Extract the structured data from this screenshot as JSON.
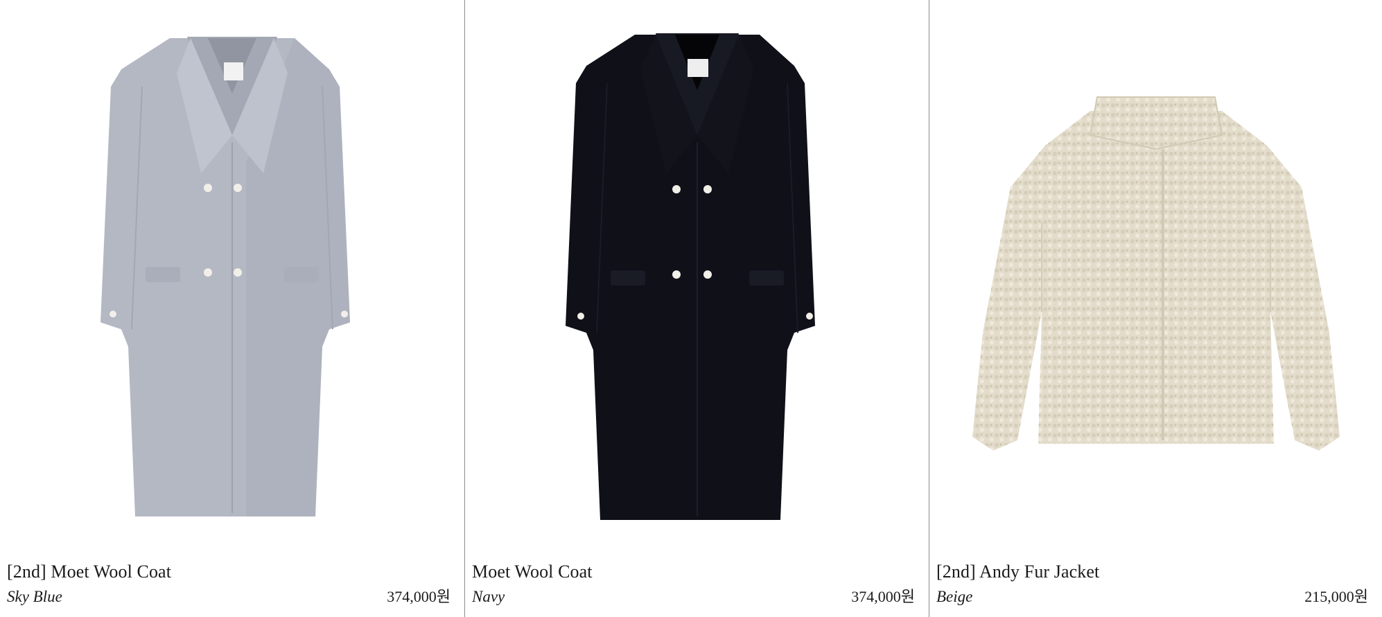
{
  "products": [
    {
      "name": "[2nd] Moet Wool Coat",
      "color": "Sky Blue",
      "price": "374,000원",
      "image_icon": "coat-image",
      "swatch": "#b3b8c3"
    },
    {
      "name": "Moet Wool Coat",
      "color": "Navy",
      "price": "374,000원",
      "image_icon": "coat-image",
      "swatch": "#0f1018"
    },
    {
      "name": "[2nd] Andy Fur Jacket",
      "color": "Beige",
      "price": "215,000원",
      "image_icon": "fur-jacket-image",
      "swatch": "#e3dccb"
    }
  ]
}
